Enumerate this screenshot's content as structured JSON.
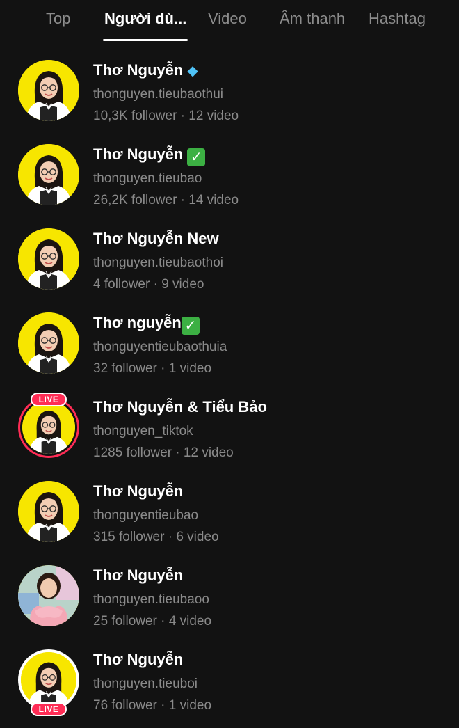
{
  "tabs": [
    {
      "label": "Top",
      "active": false
    },
    {
      "label": "Người dù...",
      "active": true
    },
    {
      "label": "Video",
      "active": false
    },
    {
      "label": "Âm thanh",
      "active": false
    },
    {
      "label": "Hashtag",
      "active": false
    }
  ],
  "users": [
    {
      "name": "Thơ Nguyễn",
      "badge": "gem",
      "handle": "thonguyen.tieubaothui",
      "stats": "10,3K follower · 12 video",
      "avatar": "yellow",
      "live": false
    },
    {
      "name": "Thơ Nguyễn",
      "badge": "check",
      "handle": "thonguyen.tieubao",
      "stats": "26,2K follower · 14 video",
      "avatar": "yellow",
      "live": false
    },
    {
      "name": "Thơ Nguyễn New",
      "badge": "",
      "handle": "thonguyen.tieubaothoi",
      "stats": "4 follower · 9 video",
      "avatar": "yellow",
      "live": false
    },
    {
      "name": "Thơ nguyễn",
      "badge": "check-tight",
      "handle": "thonguyentieubaothuia",
      "stats": "32 follower · 1 video",
      "avatar": "yellow",
      "live": false
    },
    {
      "name": "Thơ Nguyễn & Tiểu Bảo",
      "badge": "",
      "handle": "thonguyen_tiktok",
      "stats": "1285 follower · 12 video",
      "avatar": "yellow",
      "live": true,
      "live_label": "LIVE",
      "live_position": "top"
    },
    {
      "name": "Thơ Nguyễn",
      "badge": "",
      "handle": "thonguyentieubao",
      "stats": "315 follower · 6 video",
      "avatar": "yellow",
      "live": false
    },
    {
      "name": "Thơ Nguyễn",
      "badge": "",
      "handle": "thonguyen.tieubaoo",
      "stats": "25 follower · 4 video",
      "avatar": "photo-pink",
      "live": false
    },
    {
      "name": "Thơ Nguyễn",
      "badge": "",
      "handle": "thonguyen.tieuboi",
      "stats": "76 follower · 1 video",
      "avatar": "yellow-white-ring",
      "live": true,
      "live_label": "LIVE",
      "live_position": "bottom"
    }
  ],
  "colors": {
    "background": "#121212",
    "tab_inactive": "#8c8c8c",
    "secondary_text": "#8a8a8a",
    "live_accent": "#ff2c55",
    "avatar_yellow": "#f7e600"
  }
}
